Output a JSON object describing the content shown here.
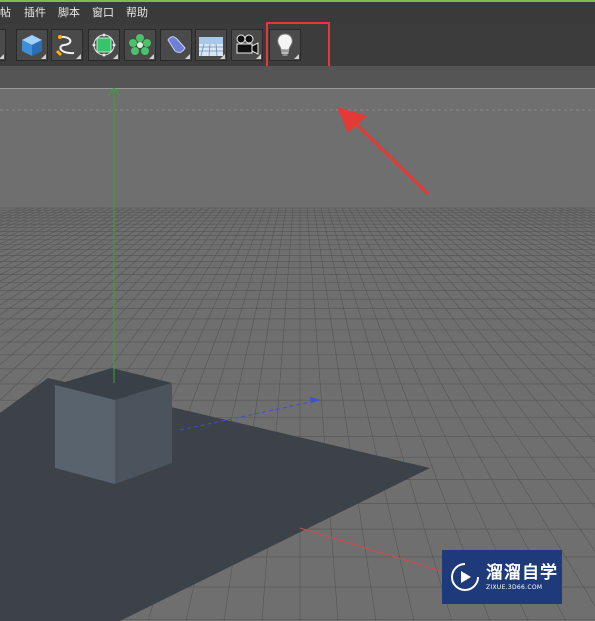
{
  "menubar": {
    "partial_item": "帖",
    "items": [
      "插件",
      "脚本",
      "窗口",
      "帮助"
    ]
  },
  "toolbar": {
    "tools": [
      {
        "icon": "cube-icon",
        "name": "cube-tool"
      },
      {
        "icon": "spline-pen-icon",
        "name": "spline-tool"
      },
      {
        "icon": "subdivision-surface-icon",
        "name": "generator-tool"
      },
      {
        "icon": "array-cloner-icon",
        "name": "mograph-tool"
      },
      {
        "icon": "deformer-icon",
        "name": "deformer-tool"
      },
      {
        "icon": "floor-plane-icon",
        "name": "scene-tool"
      },
      {
        "icon": "camera-icon",
        "name": "camera-tool"
      },
      {
        "icon": "light-bulb-icon",
        "name": "light-tool"
      }
    ]
  },
  "annotation": {
    "color": "#e53935",
    "highlighted_tool": "light-bulb-icon"
  },
  "viewport": {
    "background": "#6f6f6f",
    "grid_color": "#555555",
    "floor_color": "#3c4248",
    "cube_color": "#56606a",
    "axis_colors": {
      "y": "#3aa33a",
      "x": "#d24a4a",
      "z": "#3b4fd8"
    }
  },
  "watermark": {
    "title": "溜溜自学",
    "subtitle": "ZIXUE.3D66.COM",
    "color": "#1f3a7a"
  }
}
